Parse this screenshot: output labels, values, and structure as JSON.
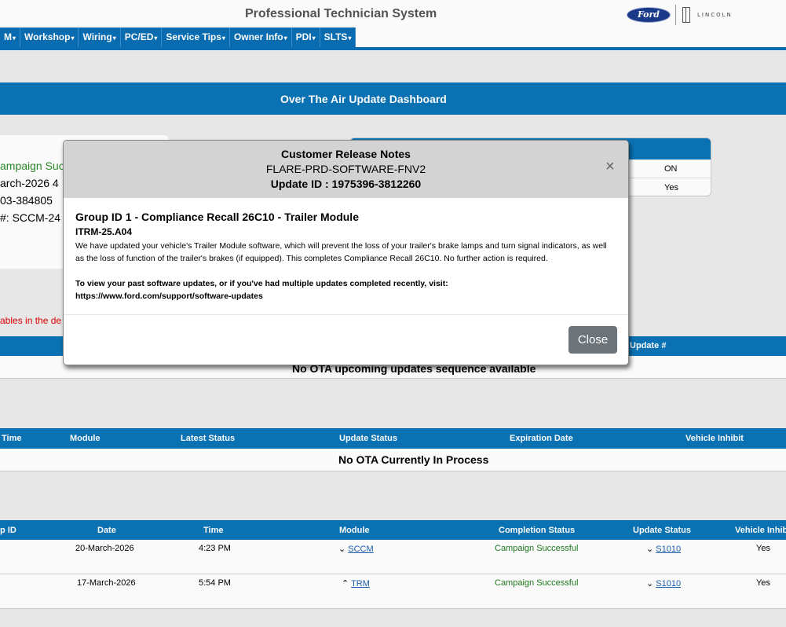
{
  "app": {
    "title": "Professional Technician System",
    "ford_logo_text": "Ford",
    "lincoln_logo_text": "LINCOLN"
  },
  "nav": [
    "M",
    "Workshop",
    "Wiring",
    "PC/ED",
    "Service Tips",
    "Owner Info",
    "PDI",
    "SLTS"
  ],
  "dashboard": {
    "title": "Over The Air Update Dashboard"
  },
  "left_card": {
    "line1": "ampaign Suc",
    "line2": "arch-2026 4",
    "line3": "03-384805",
    "line4": "#: SCCM-24"
  },
  "right_card": {
    "row1": "ON",
    "row2": "Yes"
  },
  "red_note": "ables in the de",
  "upcoming": {
    "col_update": "Update #",
    "empty": "No OTA upcoming updates sequence available"
  },
  "in_process": {
    "columns": [
      "Time",
      "Module",
      "Latest Status",
      "Update Status",
      "Expiration Date",
      "Vehicle Inhibit"
    ],
    "empty": "No OTA Currently In Process"
  },
  "history": {
    "columns": [
      "p ID",
      "Date",
      "Time",
      "Module",
      "Completion Status",
      "Update Status",
      "Vehicle Inhib"
    ],
    "rows": [
      {
        "date": "20-March-2026",
        "time": "4:23 PM",
        "module": "SCCM",
        "module_arrow": "⌄",
        "completion": "Campaign Successful",
        "update": "S1010",
        "inhibit": "Yes"
      },
      {
        "date": "17-March-2026",
        "time": "5:54 PM",
        "module": "TRM",
        "module_arrow": "⌃",
        "completion": "Campaign Successful",
        "update": "S1010",
        "inhibit": "Yes"
      }
    ]
  },
  "modal": {
    "title": "Customer Release Notes",
    "software": "FLARE-PRD-SOFTWARE-FNV2",
    "update_id": "Update ID : 1975396-3812260",
    "group_title": "Group ID 1 - Compliance Recall 26C10 - Trailer Module",
    "code": "ITRM-25.A04",
    "description": "We have updated your vehicle's Trailer Module software, which will prevent the loss of your trailer's brake lamps and turn signal indicators, as well as the loss of function of the trailer's brakes (if equipped). This completes Compliance Recall 26C10. No further action is required.",
    "visit_text": "To view your past software updates, or if you've had multiple updates completed recently, visit:",
    "visit_url": "https://www.ford.com/support/software-updates",
    "close_label": "Close",
    "close_x": "×"
  }
}
